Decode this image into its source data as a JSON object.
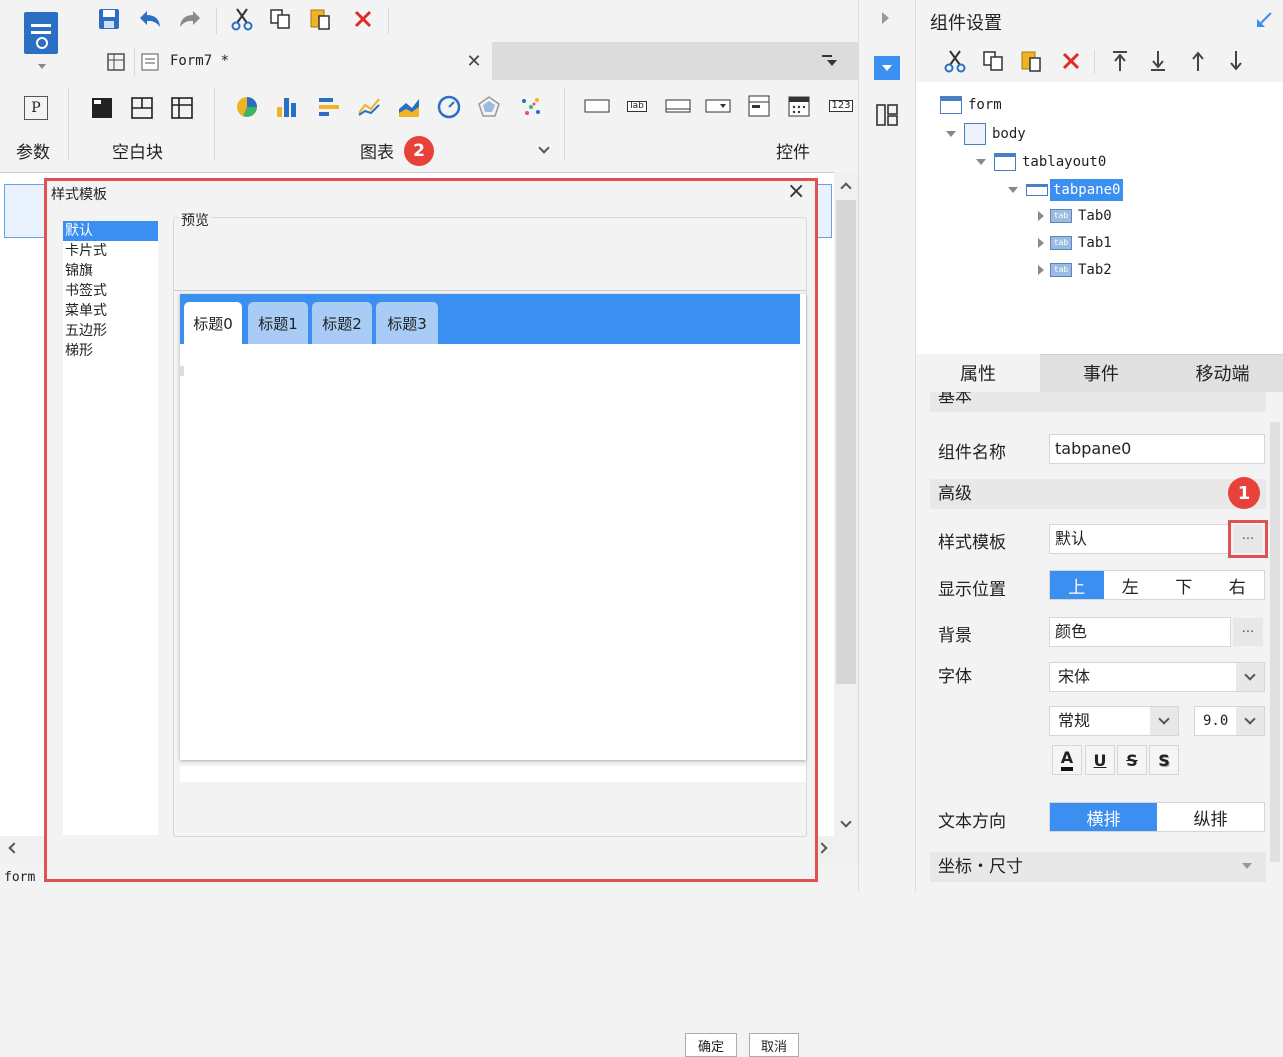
{
  "toolbar": {
    "file_tab": "Form7 *"
  },
  "ribbon": {
    "param_label": "参数",
    "blank_label": "空白块",
    "chart_label": "图表",
    "control_label": "控件",
    "chart_badge": "2",
    "param_icon": "P"
  },
  "widgets": [
    "lab",
    "123"
  ],
  "status": {
    "form_label": "form"
  },
  "panel": {
    "title": "组件设置"
  },
  "tree": {
    "form": "form",
    "body": "body",
    "tablayout": "tablayout0",
    "tabpane": "tabpane0",
    "tabs": [
      "Tab0",
      "Tab1",
      "Tab2"
    ],
    "tab_icon": "tab"
  },
  "prop_tabs": [
    "属性",
    "事件",
    "移动端"
  ],
  "props": {
    "section_partial": "基本",
    "name_label": "组件名称",
    "name_value": "tabpane0",
    "advanced": "高级",
    "style_label": "样式模板",
    "style_value": "默认",
    "ellipsis": "···",
    "badge1": "1",
    "position_label": "显示位置",
    "positions": [
      "上",
      "左",
      "下",
      "右"
    ],
    "bg_label": "背景",
    "bg_value": "颜色",
    "font_label": "字体",
    "font_value": "宋体",
    "font_style": "常规",
    "font_size": "9.0",
    "fmt": [
      "A",
      "U",
      "S",
      "S"
    ],
    "dir_label": "文本方向",
    "dirs": [
      "横排",
      "纵排"
    ],
    "coord": "坐标・尺寸"
  },
  "dialog": {
    "title": "样式模板",
    "list": [
      "默认",
      "卡片式",
      "锦旗",
      "书签式",
      "菜单式",
      "五边形",
      "梯形"
    ],
    "preview_label": "预览",
    "preview_tabs": [
      "标题0",
      "标题1",
      "标题2",
      "标题3"
    ],
    "ok": "确定",
    "cancel": "取消",
    "close": "×"
  },
  "colors": {
    "accent": "#3b8ff0",
    "highlight_border": "#e05252",
    "badge": "#e8413a"
  }
}
